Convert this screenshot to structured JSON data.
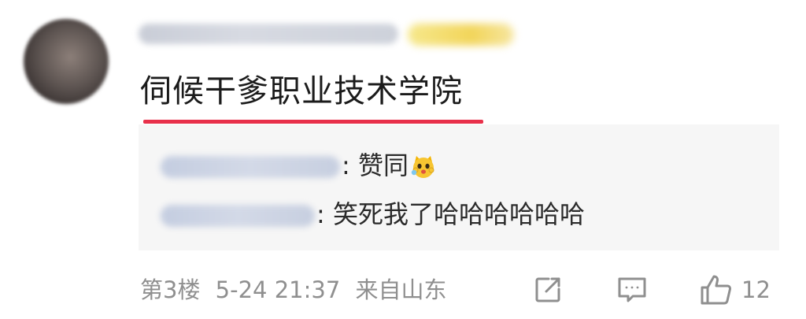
{
  "comment": {
    "text": "伺候干爹职业技术学院"
  },
  "replies": [
    {
      "text": ": 赞同",
      "emoji": "smiling-cat-emoji"
    },
    {
      "text": ": 笑死我了哈哈哈哈哈哈"
    }
  ],
  "meta": {
    "floor": "第3楼",
    "datetime": "5-24 21:37",
    "location": "来自山东"
  },
  "actions": {
    "share_icon": "share-icon",
    "reply_icon": "comment-icon",
    "like_icon": "thumbs-up-icon",
    "like_count": "12"
  },
  "colors": {
    "underline": "#e8304a",
    "reply_bg": "#f6f6f6",
    "meta_text": "#8f8f8f"
  }
}
